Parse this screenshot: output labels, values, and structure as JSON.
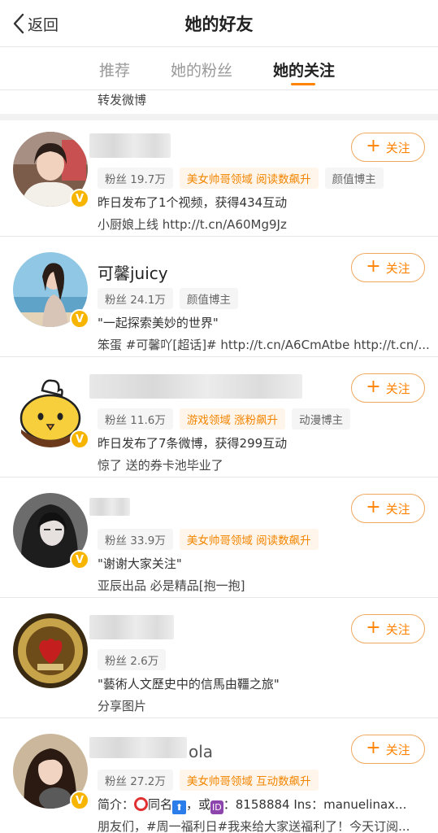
{
  "header": {
    "back_label": "返回",
    "title": "她的好友"
  },
  "tabs": [
    {
      "label": "推荐"
    },
    {
      "label": "她的粉丝"
    },
    {
      "label": "她的关注"
    }
  ],
  "active_tab": "她的关注",
  "top_tail_text": "转发微博",
  "follow_label": "关注",
  "accent_color": "#ff8200",
  "users": [
    {
      "name": "",
      "fans": "粉丝 19.7万",
      "tags": [
        "美女帅哥领域 阅读数飙升",
        "颜值博主"
      ],
      "line1": "昨日发布了1个视频，获得434互动",
      "line2": "小厨娘上线 http://t.cn/A60Mg9Jz"
    },
    {
      "name": "可馨juicy",
      "fans": "粉丝 24.1万",
      "tags": [
        "颜值博主"
      ],
      "line1": "\"一起探索美妙的世界\"",
      "line2": "笨蛋 #可馨吖[超话]# http://t.cn/A6CmAtbe http://t.cn/..."
    },
    {
      "name": "",
      "fans": "粉丝 11.6万",
      "tags": [
        "游戏领域 涨粉飙升",
        "动漫博主"
      ],
      "line1": "昨日发布了7条微博，获得299互动",
      "line2": "惊了 送的券卡池毕业了"
    },
    {
      "name": "",
      "fans": "粉丝 33.9万",
      "tags": [
        "美女帅哥领域 阅读数飙升"
      ],
      "line1": "\"谢谢大家关注\"",
      "line2": "亚辰出品 必是精品[抱一抱]"
    },
    {
      "name": "",
      "fans": "粉丝 2.6万",
      "tags": [],
      "line1": "\"藝術人文歷史中的信馬由韁之旅\"",
      "line2": "分享图片"
    },
    {
      "name": "ola",
      "fans": "粉丝 27.2万",
      "tags": [
        "美女帅哥领域 互动数飙升"
      ],
      "line1_prefix": "简介：",
      "line1_a": "同名",
      "line1_b": "，或",
      "line1_c": "：8158884 Ins：manuelinax...",
      "line2": "朋友们，#周一福利日#我来给大家送福利了！今天订阅..."
    }
  ]
}
